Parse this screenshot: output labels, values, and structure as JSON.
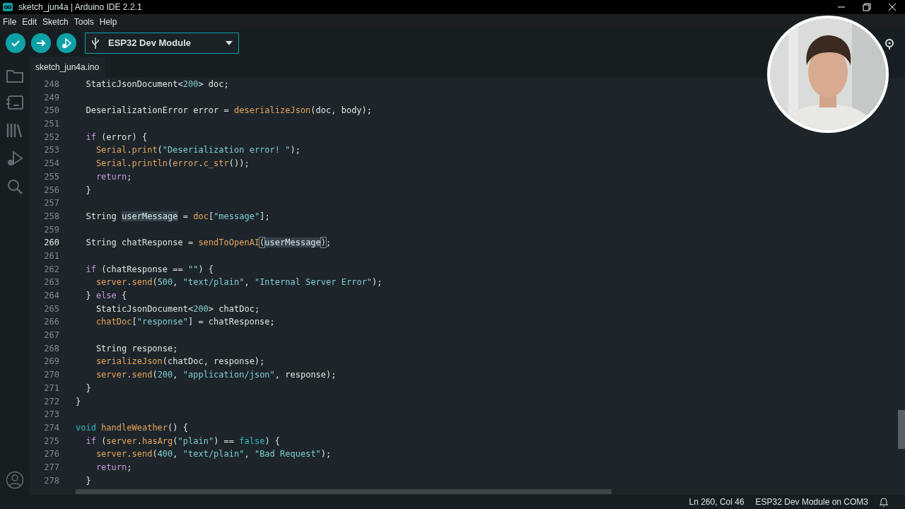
{
  "window": {
    "title": "sketch_jun4a | Arduino IDE 2.2.1"
  },
  "menu": [
    "File",
    "Edit",
    "Sketch",
    "Tools",
    "Help"
  ],
  "toolbar": {
    "board": "ESP32 Dev Module"
  },
  "tabs": [
    {
      "label": "sketch_jun4a.ino",
      "selected": true
    }
  ],
  "editor": {
    "lines": [
      {
        "number": "248",
        "current": false,
        "tokens": [
          {
            "kind": "plain",
            "text": "  StaticJsonDocument<"
          },
          {
            "kind": "number",
            "text": "200"
          },
          {
            "kind": "plain",
            "text": "> doc;"
          }
        ]
      },
      {
        "number": "249",
        "current": false
      },
      {
        "number": "250",
        "current": false,
        "tokens": [
          {
            "kind": "plain",
            "text": "  DeserializationError error = "
          },
          {
            "kind": "function",
            "text": "deserializeJson"
          },
          {
            "kind": "plain",
            "text": "(doc, body);"
          }
        ]
      },
      {
        "number": "251",
        "current": false
      },
      {
        "number": "252",
        "current": false,
        "tokens": [
          {
            "kind": "keyword",
            "text": "  if"
          },
          {
            "kind": "plain",
            "text": " (error) {"
          }
        ]
      },
      {
        "number": "253",
        "current": false,
        "tokens": [
          {
            "kind": "function",
            "text": "    Serial"
          },
          {
            "kind": "plain",
            "text": "."
          },
          {
            "kind": "function",
            "text": "print"
          },
          {
            "kind": "plain",
            "text": "("
          },
          {
            "kind": "string",
            "text": "\"Deserialization error! \""
          },
          {
            "kind": "plain",
            "text": ");"
          }
        ]
      },
      {
        "number": "254",
        "current": false,
        "tokens": [
          {
            "kind": "function",
            "text": "    Serial"
          },
          {
            "kind": "plain",
            "text": "."
          },
          {
            "kind": "function",
            "text": "println"
          },
          {
            "kind": "plain",
            "text": "("
          },
          {
            "kind": "function",
            "text": "error"
          },
          {
            "kind": "plain",
            "text": "."
          },
          {
            "kind": "function",
            "text": "c_str"
          },
          {
            "kind": "plain",
            "text": "());"
          }
        ]
      },
      {
        "number": "255",
        "current": false,
        "tokens": [
          {
            "kind": "keyword",
            "text": "    return"
          },
          {
            "kind": "plain",
            "text": ";"
          }
        ]
      },
      {
        "number": "256",
        "current": false,
        "tokens": [
          {
            "kind": "plain",
            "text": "  }"
          }
        ]
      },
      {
        "number": "257",
        "current": false
      },
      {
        "number": "258",
        "current": false,
        "tokens": [
          {
            "kind": "plain",
            "text": "  String "
          },
          {
            "kind": "highlight",
            "text": "userMessage"
          },
          {
            "kind": "plain",
            "text": " = "
          },
          {
            "kind": "function",
            "text": "doc"
          },
          {
            "kind": "plain",
            "text": "["
          },
          {
            "kind": "string",
            "text": "\"message\""
          },
          {
            "kind": "plain",
            "text": "];"
          }
        ]
      },
      {
        "number": "259",
        "current": false
      },
      {
        "number": "260",
        "current": true,
        "tokens": [
          {
            "kind": "plain",
            "text": "  String chatResponse = "
          },
          {
            "kind": "function",
            "text": "sendToOpenAI"
          },
          {
            "kind": "bracket",
            "text": "("
          },
          {
            "kind": "highlight",
            "text": "userMessage"
          },
          {
            "kind": "bracket",
            "text": ")"
          },
          {
            "kind": "plain",
            "text": ";"
          }
        ]
      },
      {
        "number": "261",
        "current": false
      },
      {
        "number": "262",
        "current": false,
        "tokens": [
          {
            "kind": "keyword",
            "text": "  if"
          },
          {
            "kind": "plain",
            "text": " (chatResponse == "
          },
          {
            "kind": "string",
            "text": "\"\""
          },
          {
            "kind": "plain",
            "text": ") {"
          }
        ]
      },
      {
        "number": "263",
        "current": false,
        "tokens": [
          {
            "kind": "function",
            "text": "    server"
          },
          {
            "kind": "plain",
            "text": "."
          },
          {
            "kind": "function",
            "text": "send"
          },
          {
            "kind": "plain",
            "text": "("
          },
          {
            "kind": "number",
            "text": "500"
          },
          {
            "kind": "plain",
            "text": ", "
          },
          {
            "kind": "string",
            "text": "\"text/plain\""
          },
          {
            "kind": "plain",
            "text": ", "
          },
          {
            "kind": "string",
            "text": "\"Internal Server Error\""
          },
          {
            "kind": "plain",
            "text": ");"
          }
        ]
      },
      {
        "number": "264",
        "current": false,
        "tokens": [
          {
            "kind": "plain",
            "text": "  } "
          },
          {
            "kind": "keyword",
            "text": "else"
          },
          {
            "kind": "plain",
            "text": " {"
          }
        ]
      },
      {
        "number": "265",
        "current": false,
        "tokens": [
          {
            "kind": "plain",
            "text": "    StaticJsonDocument<"
          },
          {
            "kind": "number",
            "text": "200"
          },
          {
            "kind": "plain",
            "text": "> chatDoc;"
          }
        ]
      },
      {
        "number": "266",
        "current": false,
        "tokens": [
          {
            "kind": "function",
            "text": "    chatDoc"
          },
          {
            "kind": "plain",
            "text": "["
          },
          {
            "kind": "string",
            "text": "\"response\""
          },
          {
            "kind": "plain",
            "text": "] = chatResponse;"
          }
        ]
      },
      {
        "number": "267",
        "current": false
      },
      {
        "number": "268",
        "current": false,
        "tokens": [
          {
            "kind": "plain",
            "text": "    String response;"
          }
        ]
      },
      {
        "number": "269",
        "current": false,
        "tokens": [
          {
            "kind": "function",
            "text": "    serializeJson"
          },
          {
            "kind": "plain",
            "text": "(chatDoc, response);"
          }
        ]
      },
      {
        "number": "270",
        "current": false,
        "tokens": [
          {
            "kind": "function",
            "text": "    server"
          },
          {
            "kind": "plain",
            "text": "."
          },
          {
            "kind": "function",
            "text": "send"
          },
          {
            "kind": "plain",
            "text": "("
          },
          {
            "kind": "number",
            "text": "200"
          },
          {
            "kind": "plain",
            "text": ", "
          },
          {
            "kind": "string",
            "text": "\"application/json\""
          },
          {
            "kind": "plain",
            "text": ", response);"
          }
        ]
      },
      {
        "number": "271",
        "current": false,
        "tokens": [
          {
            "kind": "plain",
            "text": "  }"
          }
        ]
      },
      {
        "number": "272",
        "current": false,
        "tokens": [
          {
            "kind": "plain",
            "text": "}"
          }
        ]
      },
      {
        "number": "273",
        "current": false
      },
      {
        "number": "274",
        "current": false,
        "tokens": [
          {
            "kind": "type",
            "text": "void"
          },
          {
            "kind": "function",
            "text": " handleWeather"
          },
          {
            "kind": "plain",
            "text": "() {"
          }
        ]
      },
      {
        "number": "275",
        "current": false,
        "tokens": [
          {
            "kind": "keyword",
            "text": "  if"
          },
          {
            "kind": "plain",
            "text": " ("
          },
          {
            "kind": "function",
            "text": "server"
          },
          {
            "kind": "plain",
            "text": "."
          },
          {
            "kind": "function",
            "text": "hasArg"
          },
          {
            "kind": "plain",
            "text": "("
          },
          {
            "kind": "string",
            "text": "\"plain\""
          },
          {
            "kind": "plain",
            "text": ") == "
          },
          {
            "kind": "type",
            "text": "false"
          },
          {
            "kind": "plain",
            "text": ") {"
          }
        ]
      },
      {
        "number": "276",
        "current": false,
        "tokens": [
          {
            "kind": "function",
            "text": "    server"
          },
          {
            "kind": "plain",
            "text": "."
          },
          {
            "kind": "function",
            "text": "send"
          },
          {
            "kind": "plain",
            "text": "("
          },
          {
            "kind": "number",
            "text": "400"
          },
          {
            "kind": "plain",
            "text": ", "
          },
          {
            "kind": "string",
            "text": "\"text/plain\""
          },
          {
            "kind": "plain",
            "text": ", "
          },
          {
            "kind": "string",
            "text": "\"Bad Request\""
          },
          {
            "kind": "plain",
            "text": ");"
          }
        ]
      },
      {
        "number": "277",
        "current": false,
        "tokens": [
          {
            "kind": "keyword",
            "text": "    return"
          },
          {
            "kind": "plain",
            "text": ";"
          }
        ]
      },
      {
        "number": "278",
        "current": false,
        "tokens": [
          {
            "kind": "plain",
            "text": "  }"
          }
        ]
      }
    ]
  },
  "status_bar": {
    "position": "Ln 260, Col 46",
    "board": "ESP32 Dev Module on COM3"
  }
}
